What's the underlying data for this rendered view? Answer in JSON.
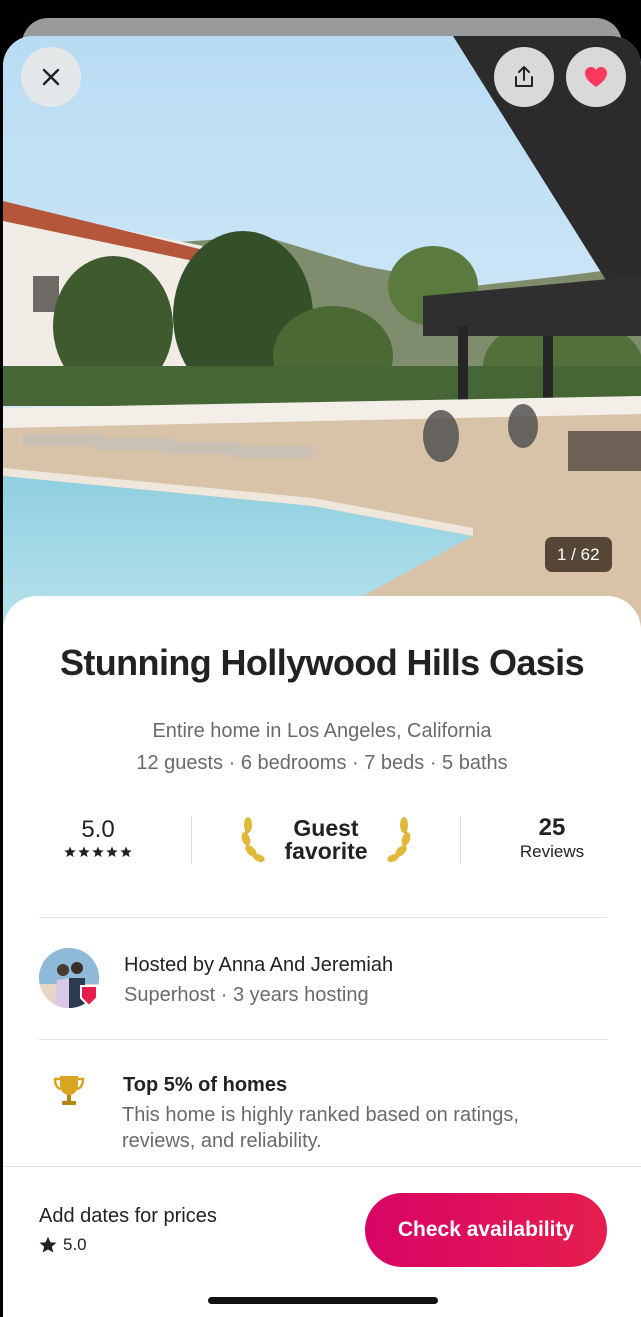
{
  "photo": {
    "counter": "1 / 62"
  },
  "actions": {
    "close_icon": "close-icon",
    "share_icon": "share-icon",
    "favorite_icon": "heart-icon",
    "favorite_color": "#ff385c"
  },
  "listing": {
    "title": "Stunning Hollywood Hills Oasis",
    "subtitle": "Entire home in Los Angeles, California",
    "stats": "12 guests · 6 bedrooms · 7 beds · 5 baths"
  },
  "rating": {
    "score": "5.0",
    "stars": 5,
    "guest_favorite_line1": "Guest",
    "guest_favorite_line2": "favorite",
    "reviews_count": "25",
    "reviews_label": "Reviews"
  },
  "host": {
    "title": "Hosted by Anna And Jeremiah",
    "subtitle": "Superhost · 3 years hosting"
  },
  "highlight": {
    "title": "Top 5% of homes",
    "description": "This home is highly ranked based on ratings, reviews, and reliability."
  },
  "footer": {
    "add_dates": "Add dates for prices",
    "rating": "5.0",
    "cta": "Check availability",
    "accent": "#e61e4d"
  }
}
